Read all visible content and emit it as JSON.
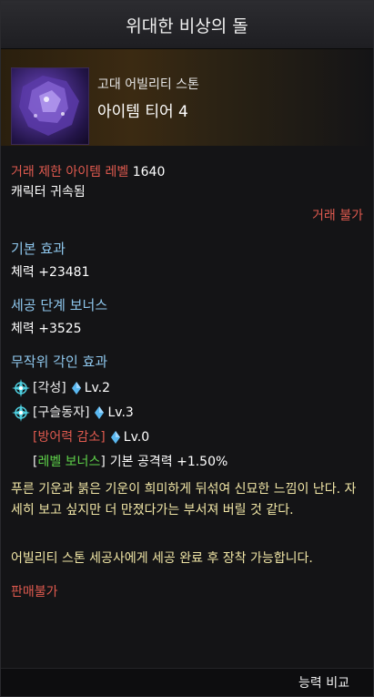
{
  "title": "위대한 비상의 돌",
  "header": {
    "category": "고대 어빌리티 스톤",
    "tier": "아이템 티어 4"
  },
  "trade_level": {
    "label": "거래 제한 아이템 레벨",
    "value": "1640"
  },
  "bind": "캐릭터 귀속됨",
  "trade_status": "거래 불가",
  "basic_effect": {
    "heading": "기본 효과",
    "value": "체력 +23481"
  },
  "bonus": {
    "heading": "세공 단계 보너스",
    "value": "체력 +3525"
  },
  "random_engrave": {
    "heading": "무작위 각인 효과",
    "items": [
      {
        "name": "[각성]",
        "level": "Lv.2",
        "color": "#ffffff",
        "has_icon": true
      },
      {
        "name": "[구슬동자]",
        "level": "Lv.3",
        "color": "#ffffff",
        "has_icon": true
      },
      {
        "name": "[방어력 감소]",
        "level": "Lv.0",
        "color": "#e05a4f",
        "has_icon": false
      }
    ],
    "level_bonus": {
      "label": "[레벨 보너스]",
      "value": "기본 공격력 +1.50%"
    }
  },
  "flavor": "푸른 기운과 붉은 기운이 희미하게 뒤섞여 신묘한 느낌이 난다. 자세히 보고 싶지만 더 만졌다가는 부서져 버릴 것 같다.",
  "usage": "어빌리티 스톤 세공사에게 세공 완료 후 장착 가능합니다.",
  "sale": "판매불가",
  "footer_button": "능력 비교",
  "colors": {
    "red": "#e05a4f",
    "blue_head": "#8fc8ee",
    "green": "#5fd34a",
    "yellow": "#f1e6a6"
  },
  "icons": {
    "engrave": "compass-icon",
    "level": "blue-gem-icon"
  }
}
